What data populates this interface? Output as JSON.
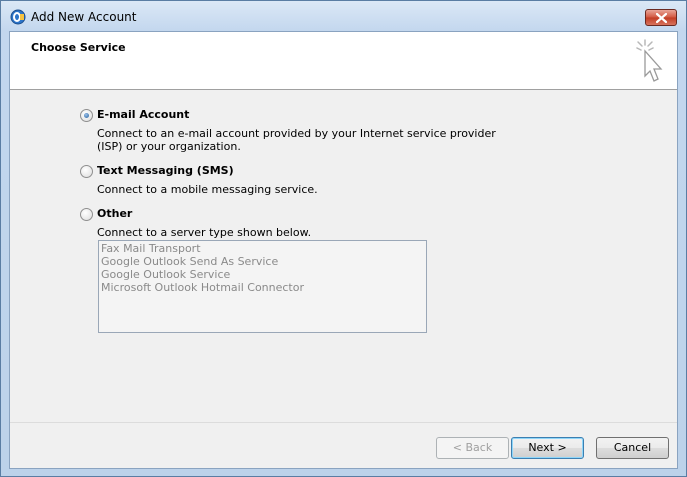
{
  "window": {
    "title": "Add New Account"
  },
  "header": {
    "title": "Choose Service"
  },
  "options": [
    {
      "label": "E-mail Account",
      "description": "Connect to an e-mail account provided by your Internet service provider (ISP) or your organization.",
      "selected": true
    },
    {
      "label": "Text Messaging (SMS)",
      "description": "Connect to a mobile messaging service.",
      "selected": false
    },
    {
      "label": "Other",
      "description": "Connect to a server type shown below.",
      "selected": false
    }
  ],
  "server_types": [
    "Fax Mail Transport",
    "Google Outlook Send As Service",
    "Google Outlook Service",
    "Microsoft Outlook Hotmail Connector"
  ],
  "buttons": {
    "back": "< Back",
    "next": "Next >",
    "cancel": "Cancel"
  },
  "colors": {
    "title_bar": "#c3d7ee",
    "close_button": "#c23c23",
    "dialog_bg": "#f0f0f0",
    "disabled_text": "#8a8a8a"
  },
  "icons": {
    "app": "outlook-icon",
    "wizard": "wizard-cursor-icon",
    "close": "close-icon"
  }
}
